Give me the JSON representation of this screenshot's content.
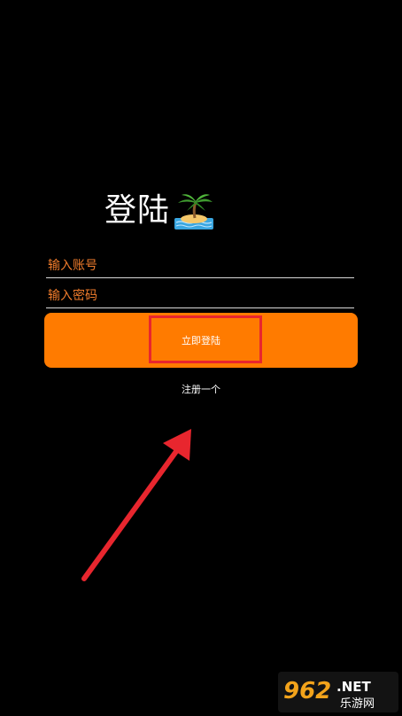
{
  "login": {
    "title": "登陆",
    "account_placeholder": "输入账号",
    "password_placeholder": "输入密码",
    "login_button_label": "立即登陆",
    "register_link_label": "注册一个"
  },
  "annotation": {
    "highlight_color": "#e8262e",
    "arrow_color": "#e8262e"
  },
  "watermark": {
    "brand_number": "962",
    "brand_suffix": ".NET",
    "brand_cn": "乐游网"
  },
  "colors": {
    "background": "#000000",
    "accent": "#ff7b00",
    "placeholder": "#f07c2c"
  }
}
